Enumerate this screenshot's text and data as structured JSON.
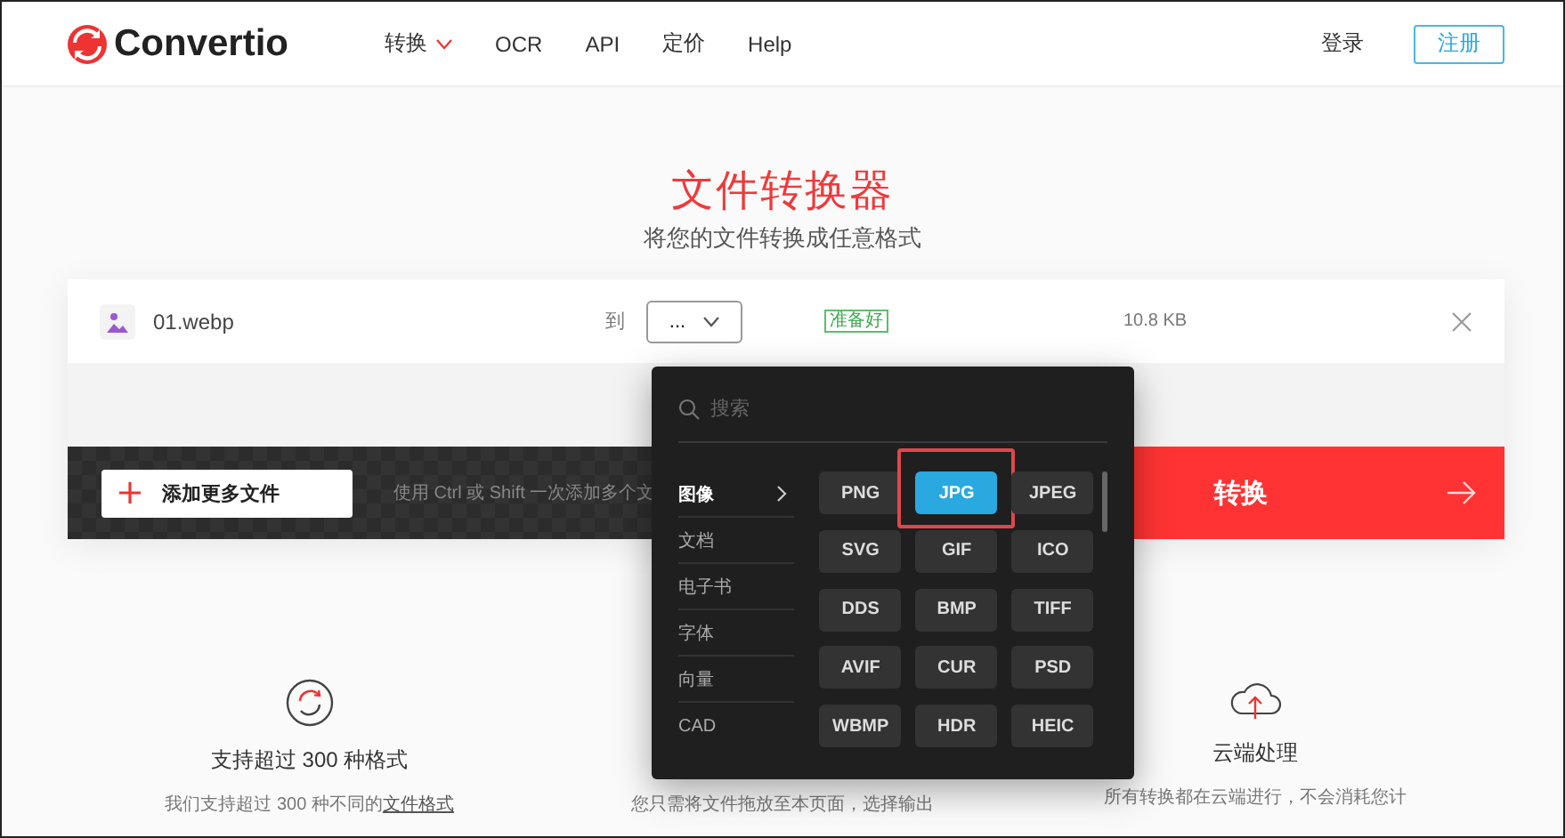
{
  "header": {
    "logo": "Convertio",
    "nav": [
      {
        "label": "转换",
        "caret": true
      },
      {
        "label": "OCR",
        "caret": false
      },
      {
        "label": "API",
        "caret": false
      },
      {
        "label": "定价",
        "caret": false
      },
      {
        "label": "Help",
        "caret": false
      }
    ],
    "login": "登录",
    "signup": "注册"
  },
  "hero": {
    "title": "文件转换器",
    "subtitle": "将您的文件转换成任意格式"
  },
  "file": {
    "name": "01.webp",
    "to_label": "到",
    "format_value": "...",
    "status": "准备好",
    "size": "10.8 KB"
  },
  "add_button": "添加更多文件",
  "hint": "使用 Ctrl 或 Shift 一次添加多个文",
  "convert_button": "转换",
  "dropdown": {
    "placeholder": "搜索",
    "categories": [
      {
        "label": "图像",
        "selected": true
      },
      {
        "label": "文档",
        "selected": false
      },
      {
        "label": "电子书",
        "selected": false
      },
      {
        "label": "字体",
        "selected": false
      },
      {
        "label": "向量",
        "selected": false
      },
      {
        "label": "CAD",
        "selected": false
      }
    ],
    "formats": [
      {
        "label": "PNG",
        "selected": false
      },
      {
        "label": "JPG",
        "selected": true
      },
      {
        "label": "JPEG",
        "selected": false
      },
      {
        "label": "SVG",
        "selected": false
      },
      {
        "label": "GIF",
        "selected": false
      },
      {
        "label": "ICO",
        "selected": false
      },
      {
        "label": "DDS",
        "selected": false
      },
      {
        "label": "BMP",
        "selected": false
      },
      {
        "label": "TIFF",
        "selected": false
      },
      {
        "label": "AVIF",
        "selected": false
      },
      {
        "label": "CUR",
        "selected": false
      },
      {
        "label": "PSD",
        "selected": false
      },
      {
        "label": "WBMP",
        "selected": false
      },
      {
        "label": "HDR",
        "selected": false
      },
      {
        "label": "HEIC",
        "selected": false
      }
    ]
  },
  "features": [
    {
      "kind": "formats",
      "title": "支持超过 300 种格式",
      "description": "我们支持超过 300 种不同的",
      "link": "文件格式"
    },
    {
      "kind": "speed",
      "description": "您只需将文件拖放至本页面，选择输出"
    },
    {
      "kind": "cloud",
      "title": "云端处理",
      "description": "所有转换都在云端进行，不会消耗您计"
    }
  ]
}
